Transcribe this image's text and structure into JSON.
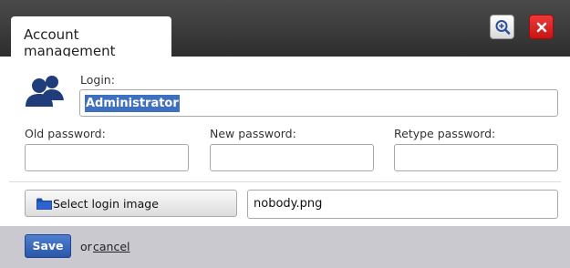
{
  "window": {
    "tab_title": "Account management"
  },
  "header_buttons": {
    "zoom_icon": "zoom-in-icon",
    "close_icon": "close-icon"
  },
  "login": {
    "label": "Login:",
    "value": "Administrator"
  },
  "passwords": {
    "old_label": "Old password:",
    "new_label": "New password:",
    "retype_label": "Retype password:",
    "old_value": "",
    "new_value": "",
    "retype_value": ""
  },
  "login_image": {
    "button_label": "Select login image",
    "filename": "nobody.png"
  },
  "footer": {
    "save_label": "Save",
    "or_text": "or",
    "cancel_label": "cancel"
  },
  "colors": {
    "accent": "#3f6fbf",
    "header_bg": "#3a3a3a",
    "close_red": "#d62020",
    "footer_bg": "#c9c9cf"
  }
}
